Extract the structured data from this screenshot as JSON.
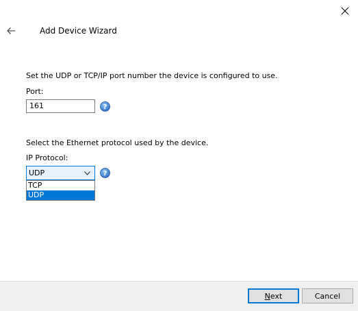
{
  "window": {
    "title": "Add Device Wizard",
    "close_icon": "close-icon",
    "back_icon": "back-arrow-icon"
  },
  "port_section": {
    "instruction": "Set the UDP or TCP/IP port number the device is configured to use.",
    "label": "Port:",
    "value": "161",
    "help_icon": "help-icon"
  },
  "protocol_section": {
    "instruction": "Select the Ethernet protocol used by the device.",
    "label": "IP Protocol:",
    "selected": "UDP",
    "options": [
      "TCP",
      "UDP"
    ],
    "help_icon": "help-icon"
  },
  "buttons": {
    "next_mnemonic": "N",
    "next_rest": "ext",
    "cancel": "Cancel"
  },
  "colors": {
    "accent": "#0078d7",
    "help_icon": "#2e6fc4",
    "footer": "#f0f0f0"
  }
}
